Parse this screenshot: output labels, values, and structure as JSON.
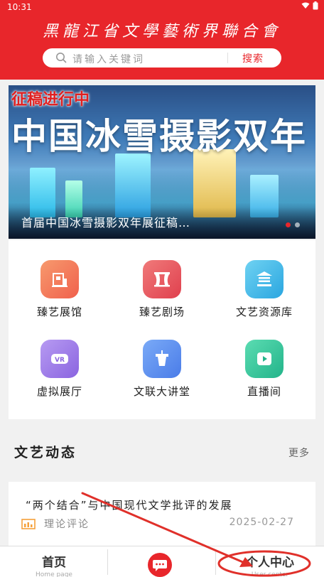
{
  "status_bar": {
    "time": "10:31"
  },
  "header": {
    "org_name": "黑龍江省文學藝術界聯合會"
  },
  "search": {
    "placeholder": "请输入关键词",
    "button_label": "搜索"
  },
  "banner": {
    "tag": "征稿进行中",
    "headline": "中国冰雪摄影双年",
    "caption": "首届中国冰雪摄影双年展征稿…",
    "slide_count": 2,
    "active_slide": 1
  },
  "features": [
    {
      "label": "臻艺展馆",
      "icon": "museum-icon",
      "color": "#f47a5f"
    },
    {
      "label": "臻艺剧场",
      "icon": "theater-icon",
      "color": "#ec5660"
    },
    {
      "label": "文艺资源库",
      "icon": "library-icon",
      "color": "#3eb5e4"
    },
    {
      "label": "虚拟展厅",
      "icon": "vr-icon",
      "color": "#9a7be6"
    },
    {
      "label": "文联大讲堂",
      "icon": "lectern-icon",
      "color": "#5b8ef0"
    },
    {
      "label": "直播间",
      "icon": "live-play-icon",
      "color": "#37c59c"
    }
  ],
  "news_section": {
    "title": "文艺动态",
    "more_label": "更多"
  },
  "news_items": [
    {
      "title": "“两个结合”与中国现代文学批评的发展",
      "category": "理论评论",
      "date": "2025-02-27"
    }
  ],
  "tabbar": {
    "home": {
      "label": "首页",
      "sub": "Home page"
    },
    "user": {
      "label": "个人中心",
      "sub": "User center"
    }
  },
  "colors": {
    "brand_red": "#e8262b",
    "annotation_red": "#e0302a"
  }
}
